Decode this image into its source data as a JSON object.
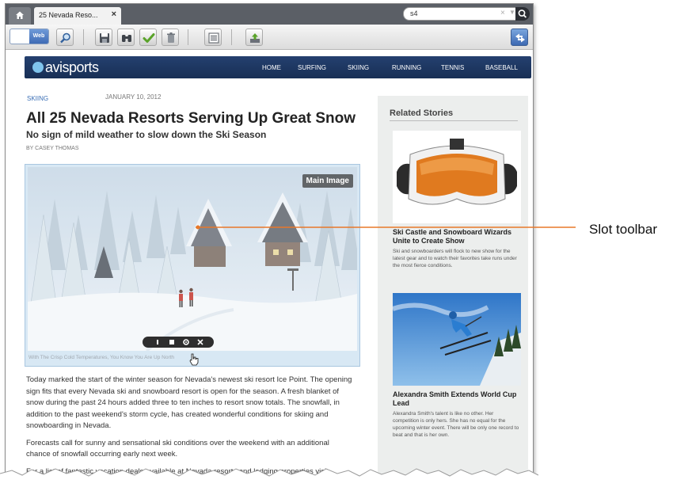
{
  "browser": {
    "tab_title": "25 Nevada Reso...",
    "tab_close": "×",
    "search_value": "s4",
    "search_clear": "×",
    "mode_toggle_label": "Web"
  },
  "site": {
    "logo_text": "avisports",
    "nav": [
      "HOME",
      "SURFING",
      "SKIING",
      "RUNNING",
      "TENNIS",
      "BASEBALL"
    ]
  },
  "article": {
    "section": "SKIING",
    "date": "JANUARY 10, 2012",
    "headline": "All 25 Nevada Resorts Serving Up Great Snow",
    "subheadline": "No sign of mild weather to slow down the Ski Season",
    "byline": "BY CASEY THOMAS",
    "slot_label": "Main Image",
    "image_caption": "With The Crisp Cold Temperatures, You Know You Are Up North",
    "paragraphs": [
      "Today marked the start of the winter season for Nevada's newest ski resort Ice Point. The opening sign fits that every Nevada ski and snowboard resort is open for the season. A fresh blanket of snow during the past 24 hours added three to ten inches to resort snow totals. The snowfall, in addition to the past weekend's storm cycle, has created wonderful conditions for skiing and snowboarding in Nevada.",
      "Forecasts call for sunny and sensational ski conditions over the weekend with an additional chance of snowfall occurring early next week.",
      "For a list of fantastic vacation deals available at Nevada resorts and lodging properties visit"
    ]
  },
  "related": {
    "title": "Related Stories",
    "stories": [
      {
        "title": "Ski Castle and Snowboard Wizards Unite to Create Show",
        "blurb": "Ski and snowboarders will flock to new show for the latest gear and to watch their favorites take runs under the most fierce conditions."
      },
      {
        "title": "Alexandra Smith Extends World Cup Lead",
        "blurb": "Alexandra Smith's talent is like no other. Her competition is only hers. She has no equal for the upcoming winter event. There will be only one record to beat and that is her own."
      }
    ]
  },
  "annotation": {
    "callout_label": "Slot toolbar",
    "callout_color": "#e8782a"
  }
}
